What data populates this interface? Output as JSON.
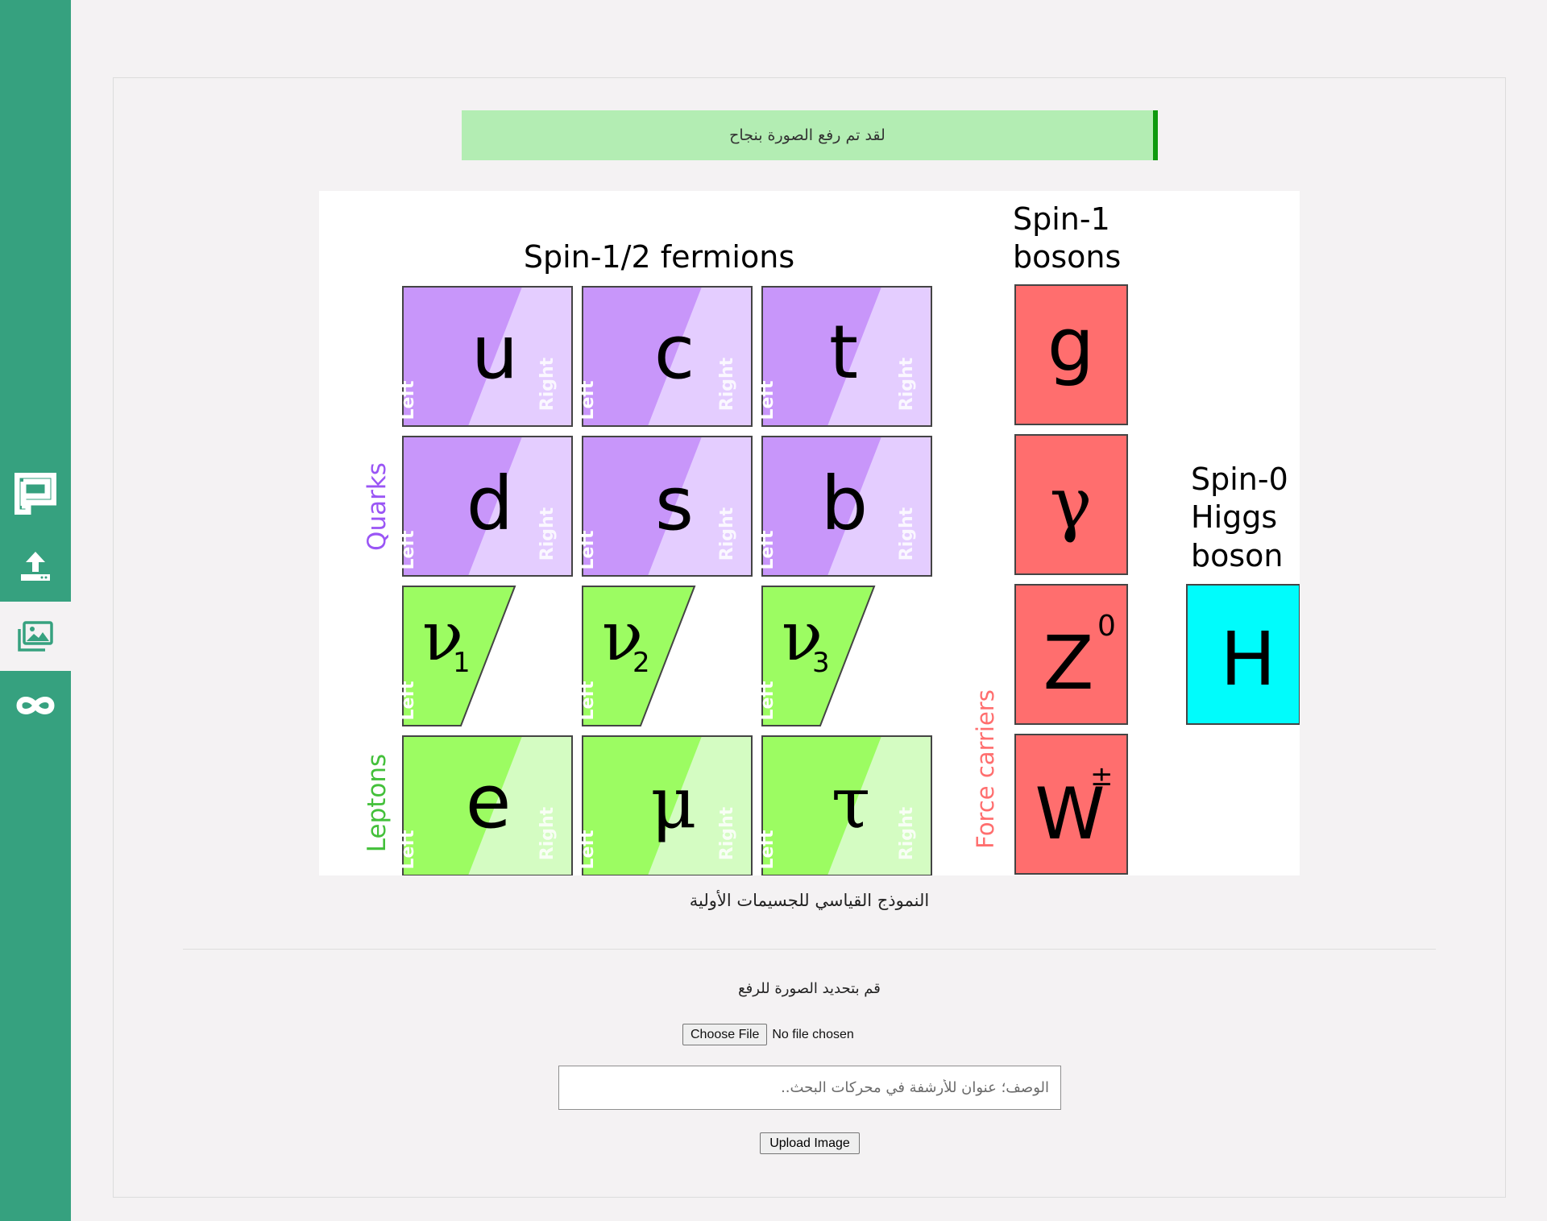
{
  "sidebar": {
    "items": [
      {
        "icon": "logo-icon"
      },
      {
        "icon": "upload-icon"
      },
      {
        "icon": "gallery-icon",
        "active": true
      },
      {
        "icon": "infinity-icon"
      }
    ]
  },
  "alert": {
    "message": "لقد تم رفع الصورة بنجاح"
  },
  "figure": {
    "fermions_title": "Spin-1/2 fermions",
    "bosons_title_1": "Spin-1",
    "bosons_title_2": "bosons",
    "higgs_title_1": "Spin-0",
    "higgs_title_2": "Higgs",
    "higgs_title_3": "boson",
    "quarks_label": "Quarks",
    "leptons_label": "Leptons",
    "force_label": "Force carriers",
    "left_label": "Left",
    "right_label": "Right",
    "quarks_row1": [
      "u",
      "c",
      "t"
    ],
    "quarks_row2": [
      "d",
      "s",
      "b"
    ],
    "neutrinos": [
      {
        "symbol": "ν",
        "sub": "1"
      },
      {
        "symbol": "ν",
        "sub": "2"
      },
      {
        "symbol": "ν",
        "sub": "3"
      }
    ],
    "leptons": [
      "e",
      "μ",
      "τ"
    ],
    "bosons": [
      {
        "symbol": "g",
        "sup": ""
      },
      {
        "symbol": "γ",
        "sup": ""
      },
      {
        "symbol": "Z",
        "sup": "0"
      },
      {
        "symbol": "W",
        "sup": "±"
      }
    ],
    "higgs": "H",
    "colors": {
      "quark_dark": "#c896fa",
      "quark_light": "#e4cdff",
      "quark_text": "#9a55f5",
      "lepton_dark": "#9cfc62",
      "lepton_light": "#d4fcc2",
      "lepton_text": "#43c03a",
      "boson": "#ff6e6e",
      "boson_text": "#ff6e6e",
      "higgs": "#00fcfc"
    }
  },
  "caption": "النموذج القياسي للجسيمات الأولية",
  "form": {
    "instruction": "قم بتحديد الصورة للرفع",
    "file_button": "Choose File",
    "file_status": "No file chosen",
    "description_placeholder": "الوصف؛ عنوان للأرشفة في محركات البحث..",
    "upload_button": "Upload Image"
  }
}
